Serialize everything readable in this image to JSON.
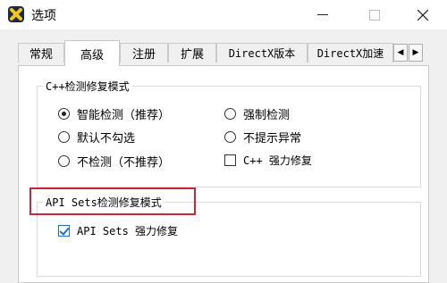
{
  "window": {
    "title": "选项"
  },
  "tabs": [
    {
      "label": "常规"
    },
    {
      "label": "高级"
    },
    {
      "label": "注册"
    },
    {
      "label": "扩展"
    },
    {
      "label": "DirectX版本"
    },
    {
      "label": "DirectX加速"
    }
  ],
  "tab_scroll": {
    "left": "◀",
    "right": "▶"
  },
  "cpp_group": {
    "title": "C++检测修复模式",
    "options": [
      {
        "label": "智能检测（推荐）",
        "selected": true
      },
      {
        "label": "强制检测",
        "selected": false
      },
      {
        "label": "默认不勾选",
        "selected": false
      },
      {
        "label": "不提示异常",
        "selected": false
      },
      {
        "label": "不检测（不推荐）",
        "selected": false
      }
    ],
    "force_repair": {
      "label": "C++ 强力修复",
      "checked": false
    }
  },
  "api_group": {
    "title": "API Sets检测修复模式",
    "force_repair": {
      "label": "API Sets 强力修复",
      "checked": true
    }
  },
  "colors": {
    "highlight": "#c9283b",
    "check": "#1a6fd1"
  }
}
